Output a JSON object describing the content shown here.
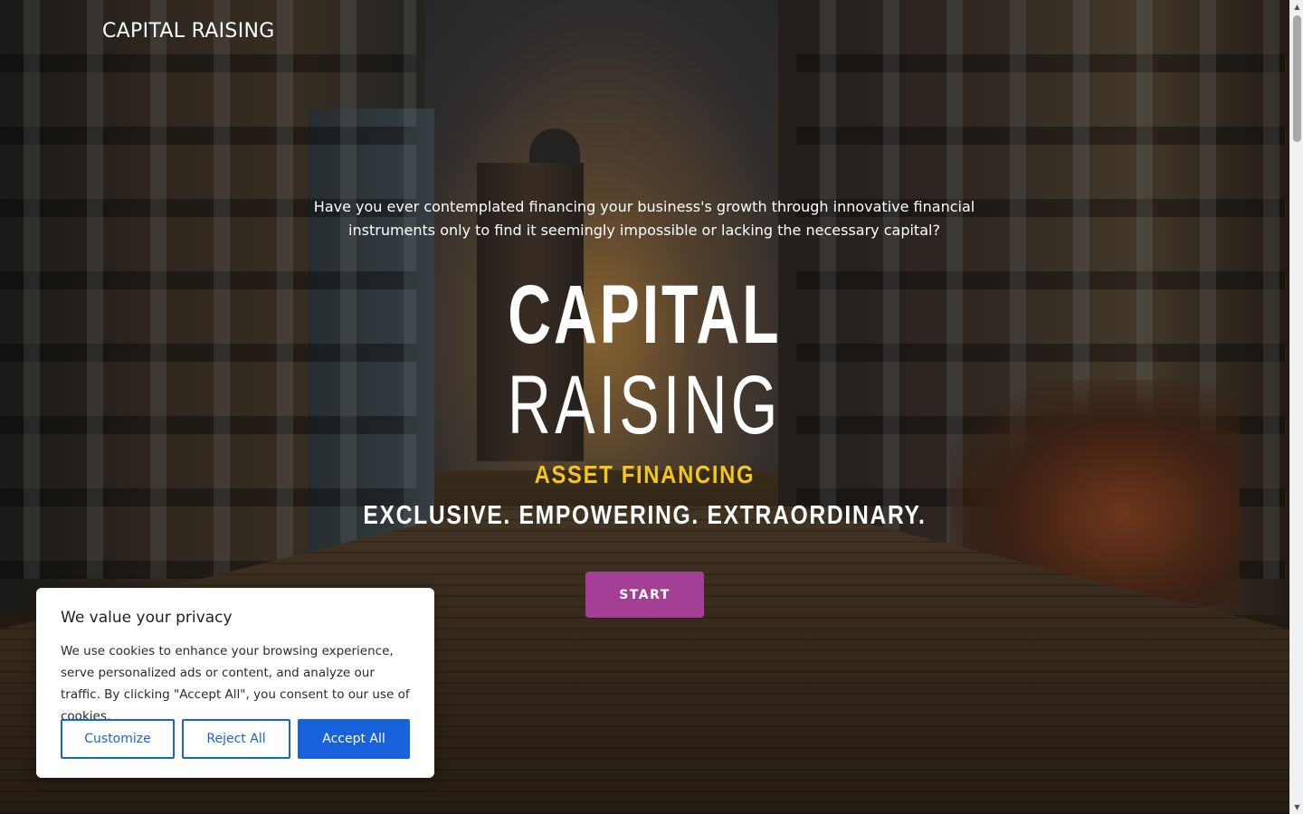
{
  "header": {
    "brand": "CAPITAL RAISING"
  },
  "hero": {
    "intro": "Have you ever contemplated financing your business's growth through innovative financial instruments only to find it seemingly impossible or lacking the necessary capital?",
    "title_line_1": "CAPITAL",
    "title_line_2": "RAISING",
    "subtitle": "ASSET FINANCING",
    "tagline": "EXCLUSIVE. EMPOWERING. EXTRAORDINARY.",
    "start_label": "START",
    "colors": {
      "subtitle": "#f5c518",
      "start_button": "#a43f96"
    }
  },
  "cookie_banner": {
    "title": "We value your privacy",
    "text": "We use cookies to enhance your browsing experience, serve personalized ads or content, and analyze our traffic. By clicking \"Accept All\", you consent to our use of cookies.",
    "customize_label": "Customize",
    "reject_label": "Reject All",
    "accept_label": "Accept All",
    "colors": {
      "accent": "#1863dc"
    }
  },
  "scrollbar": {
    "up_icon": "arrow-up-icon",
    "down_icon": "arrow-down-icon"
  }
}
